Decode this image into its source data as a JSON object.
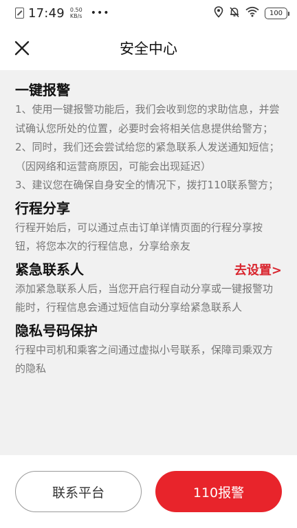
{
  "status_bar": {
    "time": "17:49",
    "speed_value": "0.50",
    "speed_unit": "KB/s",
    "more": "•••",
    "battery": "100"
  },
  "header": {
    "title": "安全中心"
  },
  "sections": [
    {
      "title": "一键报警",
      "paragraphs": [
        "1、使用一键报警功能后，我们会收到您的求助信息，并尝试确认您所处的位置，必要时会将相关信息提供给警方；",
        " 2、同时，我们还会尝试给您的紧急联系人发送通知短信；（因网络和运营商原因，可能会出现延迟）",
        " 3、建议您在确保自身安全的情况下，拨打110联系警方；"
      ]
    },
    {
      "title": "行程分享",
      "paragraphs": [
        "行程开始后，可以通过点击订单详情页面的行程分享按钮，将您本次的行程信息，分享给亲友"
      ]
    },
    {
      "title": "紧急联系人",
      "link": "去设置>",
      "paragraphs": [
        "添加紧急联系人后，当您开启行程自动分享或一键报警功能时，行程信息会通过短信自动分享给紧急联系人"
      ]
    },
    {
      "title": "隐私号码保护",
      "paragraphs": [
        "行程中司机和乘客之间通过虚拟小号联系，保障司乘双方的隐私"
      ]
    }
  ],
  "bottom": {
    "contact_label": "联系平台",
    "alarm_label": "110报警"
  },
  "colors": {
    "accent": "#e8242b",
    "link": "#d9262f",
    "content_bg": "#f1f1f1"
  }
}
